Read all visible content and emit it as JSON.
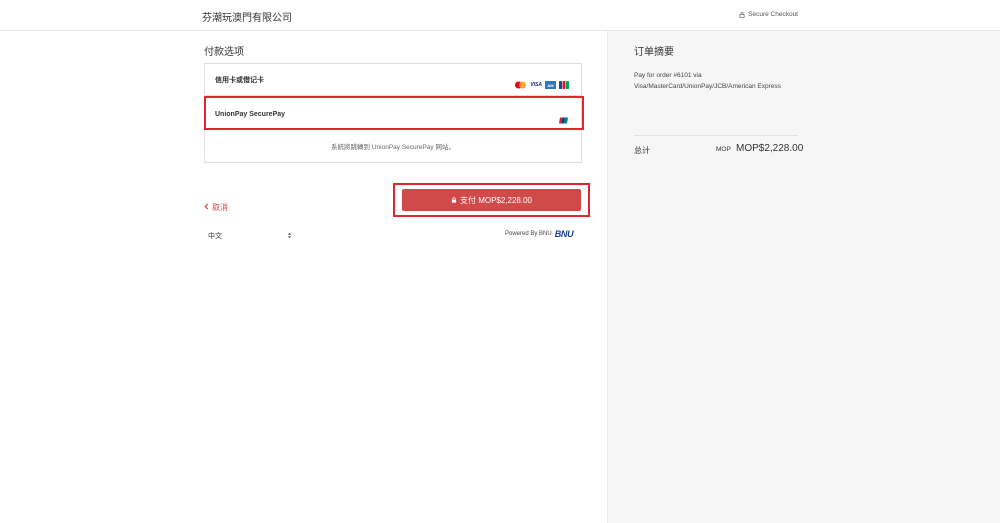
{
  "header": {
    "merchant_name": "芬潮玩澳門有限公司",
    "secure_label": "Secure Checkout",
    "secure_icon": "lock-icon"
  },
  "payment": {
    "section_title": "付款选项",
    "card_option_label": "信用卡或借记卡",
    "card_brands": [
      "mastercard-icon",
      "visa-icon",
      "amex-icon",
      "jcb-icon"
    ],
    "card_brand_text": {
      "visa": "VISA",
      "amex": "AM"
    },
    "unionpay_option_label": "UnionPay SecurePay",
    "unionpay_icon": "unionpay-icon",
    "redirect_note": "系統將跳轉到 UnionPay SecurePay 网站。",
    "highlight_color": "#e0272e"
  },
  "actions": {
    "cancel_label": "取消",
    "pay_label": "支付 MOP$2,228.00",
    "pay_button_color": "#d14a4a"
  },
  "footer": {
    "language_value": "中文",
    "powered_by": "Powered By BNU",
    "bnu_logo_text": "BNU"
  },
  "summary": {
    "title": "订单摘要",
    "order_description": "Pay for order #6101 via Visa/MasterCard/UnionPay/JCB/American Express",
    "total_label": "总计",
    "currency": "MOP",
    "total_amount": "MOP$2,228.00"
  }
}
